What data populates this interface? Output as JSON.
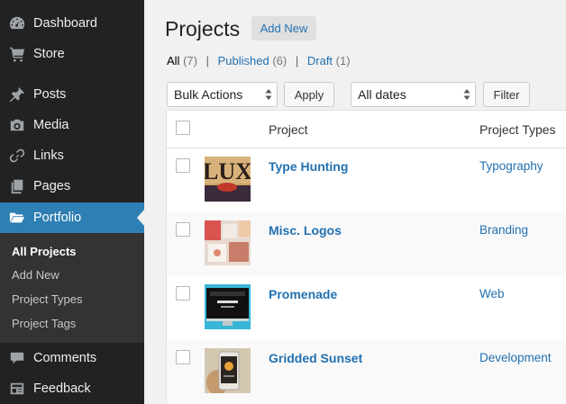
{
  "sidebar": {
    "items": [
      {
        "label": "Dashboard",
        "icon": "dashboard-icon"
      },
      {
        "label": "Store",
        "icon": "cart-icon"
      },
      {
        "label": "Posts",
        "icon": "pin-icon"
      },
      {
        "label": "Media",
        "icon": "camera-icon"
      },
      {
        "label": "Links",
        "icon": "link-icon"
      },
      {
        "label": "Pages",
        "icon": "pages-icon"
      },
      {
        "label": "Portfolio",
        "icon": "folder-icon"
      },
      {
        "label": "Comments",
        "icon": "comment-icon"
      },
      {
        "label": "Feedback",
        "icon": "feedback-icon"
      }
    ],
    "submenu": [
      "All Projects",
      "Add New",
      "Project Types",
      "Project Tags"
    ],
    "active_color": "#2e7fb3"
  },
  "header": {
    "title": "Projects",
    "add_new": "Add New"
  },
  "filters": {
    "all": "All",
    "all_count": "(7)",
    "published": "Published",
    "published_count": "(6)",
    "draft": "Draft",
    "draft_count": "(1)",
    "separator": "|"
  },
  "toolbar": {
    "bulk_actions": "Bulk Actions",
    "apply": "Apply",
    "dates": "All dates",
    "filter": "Filter"
  },
  "table": {
    "columns": [
      "Project",
      "Project Types"
    ],
    "rows": [
      {
        "title": "Type Hunting",
        "type": "Typography",
        "thumb": "lux-thumbnail"
      },
      {
        "title": "Misc. Logos",
        "type": "Branding",
        "thumb": "logos-thumbnail"
      },
      {
        "title": "Promenade",
        "type": "Web",
        "thumb": "promenade-thumbnail"
      },
      {
        "title": "Gridded Sunset",
        "type": "Development",
        "thumb": "phone-thumbnail"
      }
    ],
    "thumb_lux_text": "LUX"
  }
}
